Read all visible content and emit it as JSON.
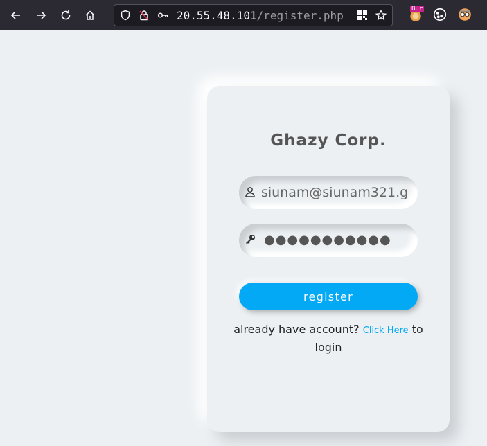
{
  "browser": {
    "url_host": "20.55.48.101",
    "url_path": "/register.php",
    "burp_badge": "Bur"
  },
  "page": {
    "title": "Ghazy Corp.",
    "email_value": "siunam@siunam321.g",
    "password_mask": "●●●●●●●●●●●",
    "register_label": "register",
    "login_prompt": "already have account?",
    "login_link": "Click Here",
    "login_suffix": "to login"
  },
  "colors": {
    "accent": "#03a9f4",
    "background": "#ecf0f3"
  }
}
